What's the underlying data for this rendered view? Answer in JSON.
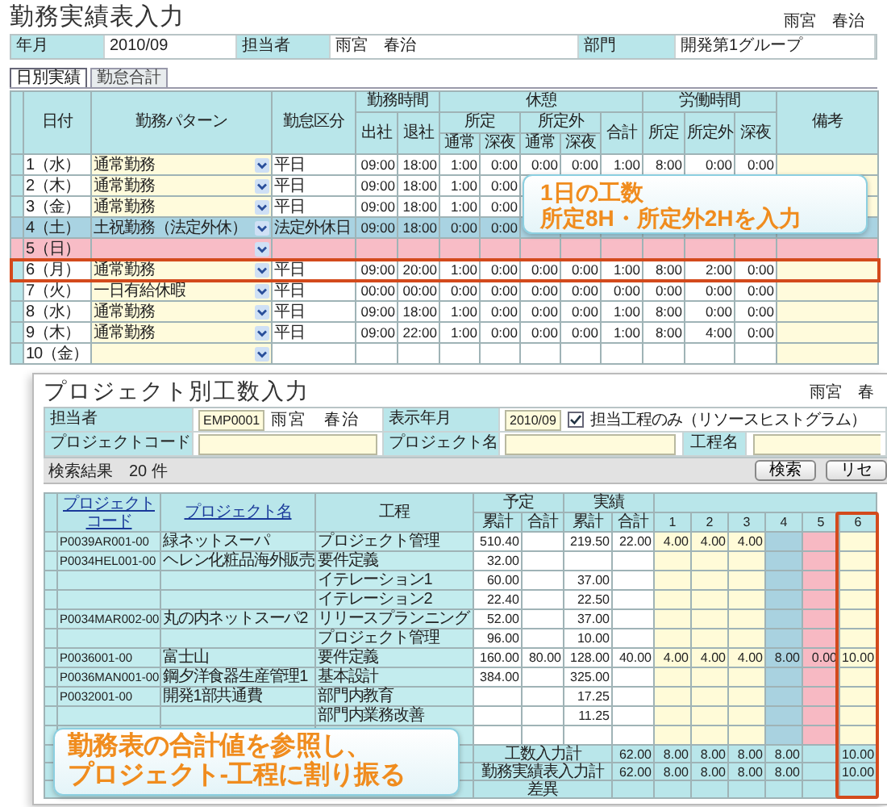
{
  "top": {
    "title": "勤務実績表入力",
    "user": "雨宮　春治",
    "info": [
      {
        "label": "年月",
        "value": "2010/09"
      },
      {
        "label": "担当者",
        "value": "雨宮　春治"
      },
      {
        "label": "部門",
        "value": "開発第1グループ"
      }
    ],
    "tabs": [
      {
        "label": "日別実績",
        "selected": true
      },
      {
        "label": "勤怠合計",
        "selected": false
      }
    ],
    "header": {
      "date": "日付",
      "pattern": "勤務パターン",
      "category": "勤怠区分",
      "attendance": {
        "title": "勤務時間",
        "in": "出社",
        "out": "退社"
      },
      "break": {
        "title": "休憩",
        "scheduled": {
          "title": "所定",
          "normal": "通常",
          "night": "深夜"
        },
        "overtime": {
          "title": "所定外",
          "normal": "通常",
          "night": "深夜"
        },
        "total": "合計"
      },
      "labor": {
        "title": "労働時間",
        "scheduled": "所定",
        "overtime": "所定外",
        "night": "深夜"
      },
      "notes": "備考"
    },
    "rows": [
      {
        "date": "1（水）",
        "pattern": "通常勤務",
        "category": "平日",
        "in": "09:00",
        "out": "18:00",
        "break_scheduled_normal": "1:00",
        "break_scheduled_night": "0:00",
        "break_overtime_normal": "0:00",
        "break_overtime_night": "0:00",
        "break_total": "1:00",
        "labor_scheduled": "8:00",
        "labor_overtime": "0:00",
        "labor_night": "0:00",
        "kind": "weekday",
        "highlighted": false
      },
      {
        "date": "2（木）",
        "pattern": "通常勤務",
        "category": "平日",
        "in": "09:00",
        "out": "18:00",
        "break_scheduled_normal": "1:00",
        "break_scheduled_night": "0:00",
        "kind": "weekday",
        "highlighted": false
      },
      {
        "date": "3（金）",
        "pattern": "通常勤務",
        "category": "平日",
        "in": "09:00",
        "out": "18:00",
        "break_scheduled_normal": "1:00",
        "break_scheduled_night": "0:00",
        "kind": "weekday",
        "highlighted": false
      },
      {
        "date": "4（土）",
        "pattern": "土祝勤務（法定外休）",
        "category": "法定外休日",
        "in": "09:00",
        "out": "18:00",
        "break_scheduled_normal": "0:00",
        "break_scheduled_night": "0:00",
        "kind": "saturday",
        "highlighted": false
      },
      {
        "date": "5（日）",
        "kind": "sunday",
        "highlighted": false
      },
      {
        "date": "6（月）",
        "pattern": "通常勤務",
        "category": "平日",
        "in": "09:00",
        "out": "20:00",
        "break_scheduled_normal": "1:00",
        "break_scheduled_night": "0:00",
        "break_overtime_normal": "0:00",
        "break_overtime_night": "0:00",
        "break_total": "1:00",
        "labor_scheduled": "8:00",
        "labor_overtime": "2:00",
        "labor_night": "0:00",
        "kind": "weekday",
        "highlighted": true
      },
      {
        "date": "7（火）",
        "pattern": "一日有給休暇",
        "category": "平日",
        "in": "00:00",
        "out": "00:00",
        "break_scheduled_normal": "0:00",
        "break_scheduled_night": "0:00",
        "break_overtime_normal": "0:00",
        "break_overtime_night": "0:00",
        "break_total": "0:00",
        "labor_scheduled": "0:00",
        "labor_overtime": "0:00",
        "labor_night": "0:00",
        "kind": "weekday",
        "highlighted": false
      },
      {
        "date": "8（水）",
        "pattern": "通常勤務",
        "category": "平日",
        "in": "09:00",
        "out": "18:00",
        "break_scheduled_normal": "1:00",
        "break_scheduled_night": "0:00",
        "break_overtime_normal": "0:00",
        "break_overtime_night": "0:00",
        "break_total": "1:00",
        "labor_scheduled": "8:00",
        "labor_overtime": "0:00",
        "labor_night": "0:00",
        "kind": "weekday",
        "highlighted": false
      },
      {
        "date": "9（木）",
        "pattern": "通常勤務",
        "category": "平日",
        "in": "09:00",
        "out": "22:00",
        "break_scheduled_normal": "1:00",
        "break_scheduled_night": "0:00",
        "break_overtime_normal": "0:00",
        "break_overtime_night": "0:00",
        "break_total": "1:00",
        "labor_scheduled": "8:00",
        "labor_overtime": "4:00",
        "labor_night": "0:00",
        "kind": "weekday",
        "highlighted": false
      },
      {
        "date": "10（金）",
        "kind": "weekday",
        "highlighted": false
      }
    ],
    "callout": [
      "1日の工数",
      "所定8H・所定外2Hを入力"
    ]
  },
  "bottom": {
    "title": "プロジェクト別工数入力",
    "user": "雨宮　春",
    "form": {
      "staff_label": "担当者",
      "staff_code": "EMP0001",
      "staff_name": "雨宮　春治",
      "month_label": "表示年月",
      "month": "2010/09",
      "own_only": {
        "label": "担当工程のみ（リソースヒストグラム）",
        "checked": true
      },
      "code_label": "プロジェクトコード",
      "name_label": "プロジェクト名",
      "process_label": "工程名"
    },
    "result": "検索結果　20 件",
    "buttons": [
      "検索",
      "リセ"
    ],
    "header": {
      "code": "プロジェクトコード",
      "name": "プロジェクト名",
      "process": "工程",
      "plan": {
        "title": "予定",
        "cumulative": "累計",
        "total": "合計"
      },
      "actual": {
        "title": "実績",
        "cumulative": "累計",
        "total": "合計"
      }
    },
    "days": [
      {
        "label": "1",
        "kind": "weekday",
        "highlighted": false
      },
      {
        "label": "2",
        "kind": "weekday",
        "highlighted": false
      },
      {
        "label": "3",
        "kind": "weekday",
        "highlighted": false
      },
      {
        "label": "4",
        "kind": "saturday",
        "highlighted": false
      },
      {
        "label": "5",
        "kind": "sunday",
        "highlighted": false
      },
      {
        "label": "6",
        "kind": "weekday",
        "highlighted": true
      }
    ],
    "rows": [
      {
        "code": "P0039AR001-00",
        "name": "緑ネットスーパ",
        "process": "プロジェクト管理",
        "plan_cumulative": "510.40",
        "actual_cumulative": "219.50",
        "actual_total": "22.00",
        "hours": {
          "day_1": "4.00",
          "day_2": "4.00",
          "day_3": "4.00"
        }
      },
      {
        "code": "P0034HEL001-00",
        "name": "ヘレン化粧品海外販売",
        "process": "要件定義",
        "plan_cumulative": "32.00"
      },
      {
        "process": "イテレーション1",
        "plan_cumulative": "60.00",
        "actual_cumulative": "37.00"
      },
      {
        "process": "イテレーション2",
        "plan_cumulative": "22.40",
        "actual_cumulative": "22.50"
      },
      {
        "code": "P0034MAR002-00",
        "name": "丸の内ネットスーパ2",
        "process": "リリースプランニング",
        "plan_cumulative": "52.00",
        "actual_cumulative": "37.00"
      },
      {
        "process": "プロジェクト管理",
        "plan_cumulative": "96.00",
        "actual_cumulative": "10.00"
      },
      {
        "code": "P0036001-00",
        "name": "富士山",
        "process": "要件定義",
        "plan_cumulative": "160.00",
        "plan_total": "80.00",
        "actual_cumulative": "128.00",
        "actual_total": "40.00",
        "hours": {
          "day_1": "4.00",
          "day_2": "4.00",
          "day_3": "4.00",
          "day_4": "8.00",
          "day_5": "0.00",
          "day_6": "10.00"
        }
      },
      {
        "code": "P0036MAN001-00",
        "name": "鋼夕洋食器生産管理1",
        "process": "基本設計",
        "plan_cumulative": "384.00",
        "actual_cumulative": "325.00"
      },
      {
        "code": "P0032001-00",
        "name": "開発1部共通費",
        "process": "部門内教育",
        "actual_cumulative": "17.25"
      },
      {
        "process": "部門内業務改善",
        "actual_cumulative": "11.25"
      },
      {}
    ],
    "footer": [
      {
        "label": "工数入力計",
        "actual_total": "62.00",
        "hours": {
          "day_1": "8.00",
          "day_2": "8.00",
          "day_3": "8.00",
          "day_4": "8.00",
          "day_6": "10.00"
        }
      },
      {
        "label": "勤務実績表入力計",
        "actual_total": "62.00",
        "hours": {
          "day_1": "8.00",
          "day_2": "8.00",
          "day_3": "8.00",
          "day_4": "8.00",
          "day_6": "10.00"
        }
      },
      {
        "label": "差異"
      }
    ],
    "callout": [
      "勤務表の合計値を参照し、",
      "プロジェクト-工程に割り振る"
    ]
  }
}
